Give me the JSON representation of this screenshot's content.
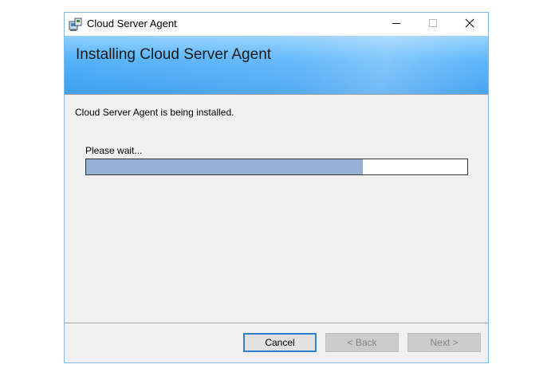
{
  "window": {
    "title": "Cloud Server Agent",
    "app_icon": "installer-icon",
    "controls": {
      "minimize_icon": "minimize-icon",
      "maximize_icon": "maximize-icon",
      "close_icon": "close-icon"
    }
  },
  "banner": {
    "title": "Installing Cloud Server Agent"
  },
  "content": {
    "status": "Cloud Server Agent is being installed.",
    "wait_label": "Please wait...",
    "progress_fraction": 0.725
  },
  "buttons": {
    "cancel": "Cancel",
    "back": "< Back",
    "next": "Next >"
  },
  "colors": {
    "banner": "#55b2f9",
    "progress_fill": "#97afd3",
    "focus_border": "#2f7fd0"
  }
}
